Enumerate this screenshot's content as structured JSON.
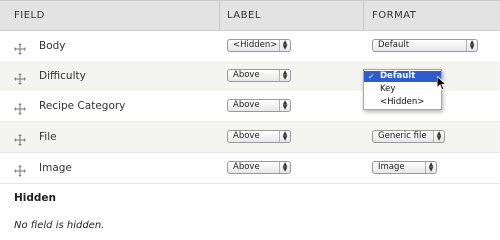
{
  "header": {
    "field": "FIELD",
    "label": "LABEL",
    "format": "FORMAT"
  },
  "rows": [
    {
      "field": "Body",
      "label": "<Hidden>",
      "format": "Default"
    },
    {
      "field": "Difficulty",
      "label": "Above",
      "format": "Default"
    },
    {
      "field": "Recipe Category",
      "label": "Above",
      "format": ""
    },
    {
      "field": "File",
      "label": "Above",
      "format": "Generic file"
    },
    {
      "field": "Image",
      "label": "Above",
      "format": "Image"
    }
  ],
  "format_dropdown": {
    "options": [
      "Default",
      "Key",
      "<Hidden>"
    ],
    "selected": "Default"
  },
  "hidden_section": {
    "title": "Hidden",
    "note": "No field is hidden."
  },
  "icons": {
    "drag": "drag-handle-icon",
    "dropdown": "updown-arrows-icon",
    "pointer": "mouse-pointer-icon",
    "check": "checkmark-icon"
  }
}
